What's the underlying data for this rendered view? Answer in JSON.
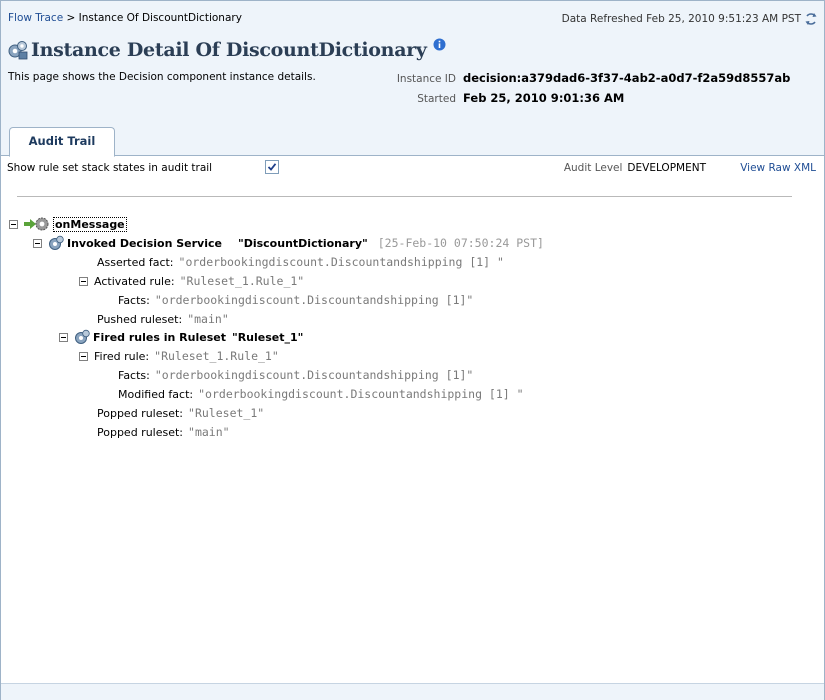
{
  "breadcrumb": {
    "link": "Flow Trace",
    "separator": " > ",
    "current": "Instance Of DiscountDictionary"
  },
  "refresh": {
    "text": "Data Refreshed Feb 25, 2010 9:51:23 AM PST"
  },
  "page": {
    "title": "Instance Detail Of DiscountDictionary",
    "description": "This page shows the Decision component instance details."
  },
  "meta": {
    "instance_id_label": "Instance ID",
    "instance_id_value": "decision:a379dad6-3f37-4ab2-a0d7-f2a59d8557ab",
    "started_label": "Started",
    "started_value": "Feb 25, 2010 9:01:36 AM"
  },
  "tabs": [
    {
      "label": "Audit Trail"
    }
  ],
  "toolbar": {
    "show_states_label": "Show rule set stack states in audit trail",
    "show_states_checked": true,
    "audit_level_label": "Audit Level",
    "audit_level_value": "DEVELOPMENT",
    "view_raw_xml": "View Raw XML"
  },
  "tree": {
    "root": "onMessage",
    "invoke": {
      "label": "Invoked Decision Service",
      "name": "\"DiscountDictionary\"",
      "timestamp": "[25-Feb-10 07:50:24 PST]"
    },
    "asserted": {
      "key": "Asserted fact:",
      "value": "\"orderbookingdiscount.Discountandshipping [1] \""
    },
    "activated": {
      "key": "Activated rule:",
      "value": "\"Ruleset_1.Rule_1\""
    },
    "activated_facts": {
      "key": "Facts:",
      "value": "\"orderbookingdiscount.Discountandshipping [1]\""
    },
    "pushed": {
      "key": "Pushed ruleset:",
      "value": "\"main\""
    },
    "fired_rules": {
      "label": "Fired rules in Ruleset",
      "name": "\"Ruleset_1\""
    },
    "fired": {
      "key": "Fired rule:",
      "value": "\"Ruleset_1.Rule_1\""
    },
    "fired_facts": {
      "key": "Facts:",
      "value": "\"orderbookingdiscount.Discountandshipping [1]\""
    },
    "modified": {
      "key": "Modified fact:",
      "value": "\"orderbookingdiscount.Discountandshipping [1] \""
    },
    "popped1": {
      "key": "Popped ruleset:",
      "value": "\"Ruleset_1\""
    },
    "popped2": {
      "key": "Popped ruleset:",
      "value": "\"main\""
    }
  },
  "colors": {
    "header_bg": "#eef4fa",
    "link": "#1f4d94",
    "title": "#2b3e55",
    "border": "#9eb3c8"
  }
}
